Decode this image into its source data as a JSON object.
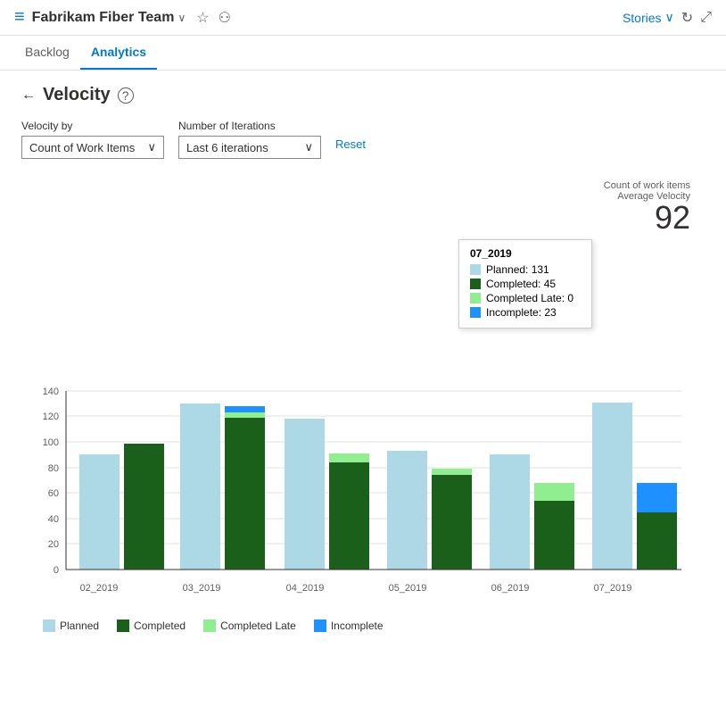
{
  "header": {
    "icon": "≡",
    "team_name": "Fabrikam Fiber Team",
    "chevron": "∨",
    "star": "☆",
    "people_icon": "⚇",
    "stories_label": "Stories",
    "stories_chevron": "∨",
    "refresh_icon": "↻",
    "expand_icon": "⤢"
  },
  "nav": {
    "tabs": [
      {
        "label": "Backlog",
        "active": false
      },
      {
        "label": "Analytics",
        "active": true
      }
    ]
  },
  "page": {
    "back_icon": "←",
    "title": "Velocity",
    "help_icon": "?"
  },
  "filters": {
    "velocity_by_label": "Velocity by",
    "velocity_by_value": "Count of Work Items",
    "iterations_label": "Number of Iterations",
    "iterations_value": "Last 6 iterations",
    "reset_label": "Reset"
  },
  "chart": {
    "avg_label_line1": "Count of work items",
    "avg_label_line2": "Average Velocity",
    "avg_value": "92",
    "y_labels": [
      "0",
      "20",
      "40",
      "60",
      "80",
      "100",
      "120",
      "140"
    ],
    "x_labels": [
      "02_2019",
      "03_2019",
      "04_2019",
      "05_2019",
      "06_2019",
      "07_2019"
    ],
    "tooltip": {
      "title": "07_2019",
      "rows": [
        {
          "color": "#add8e6",
          "label": "Planned: 131"
        },
        {
          "color": "#1a5f1a",
          "label": "Completed: 45"
        },
        {
          "color": "#90ee90",
          "label": "Completed Late: 0"
        },
        {
          "color": "#1e90ff",
          "label": "Incomplete: 23"
        }
      ]
    },
    "legend": [
      {
        "color": "#add8e6",
        "label": "Planned"
      },
      {
        "color": "#1a5f1a",
        "label": "Completed"
      },
      {
        "color": "#90ee90",
        "label": "Completed Late"
      },
      {
        "color": "#1e90ff",
        "label": "Incomplete"
      }
    ]
  }
}
